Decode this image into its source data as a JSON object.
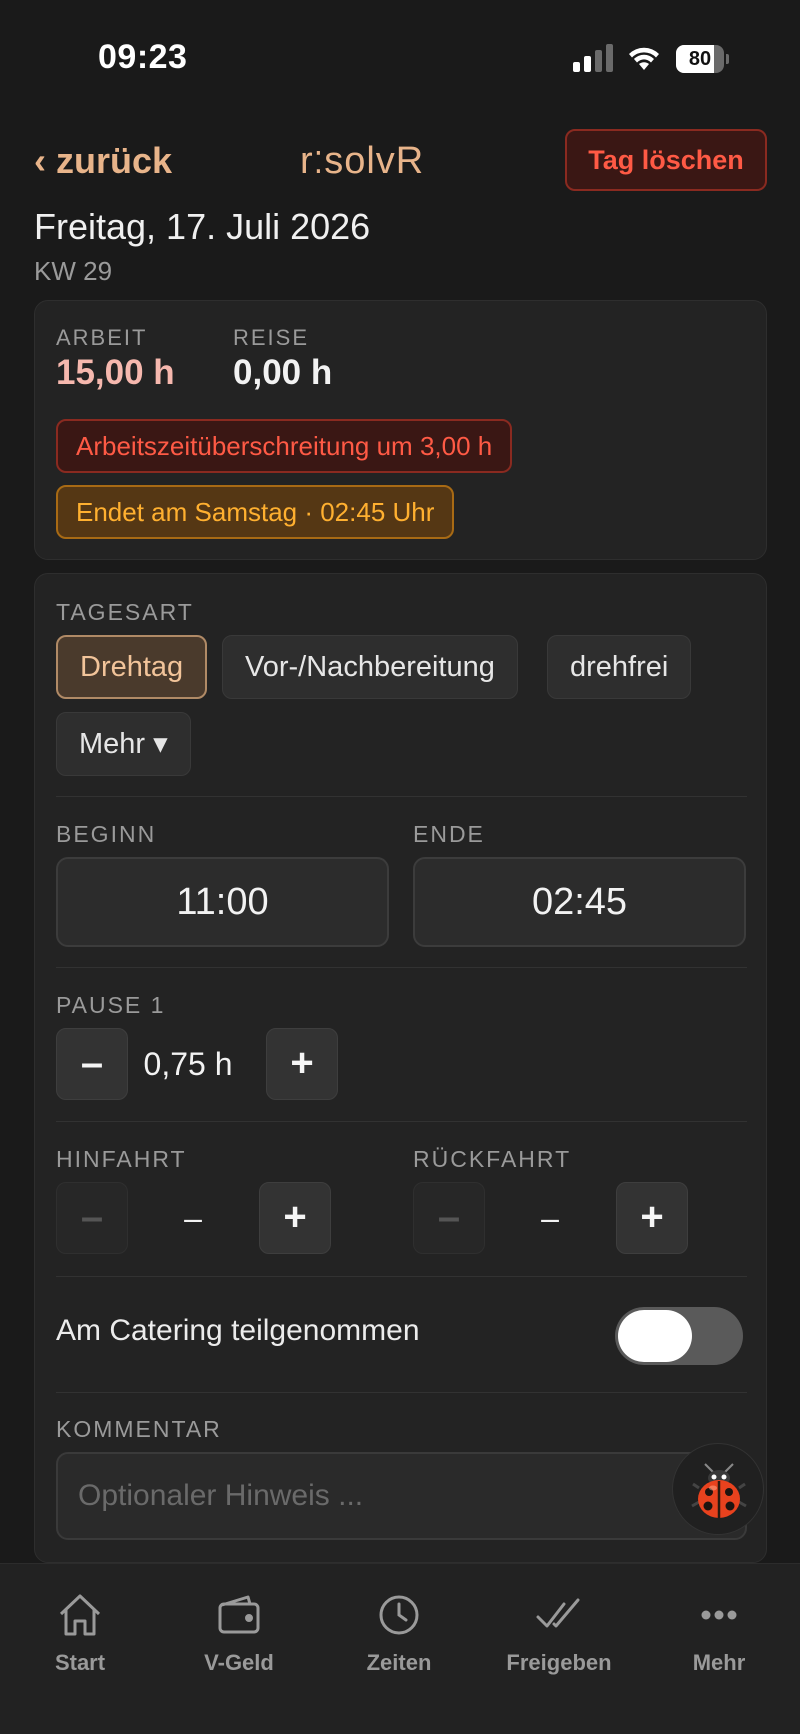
{
  "status_bar": {
    "time": "09:23",
    "battery": "80",
    "battery_level": 0.8
  },
  "header": {
    "back_label": "‹ zurück",
    "logo_left": "r",
    "logo_dots": "⁚",
    "logo_right": "solvR",
    "delete_label": "Tag löschen"
  },
  "day": {
    "title": "Freitag, 17. Juli 2026",
    "week": "KW 29"
  },
  "summary": {
    "work_label": "ARBEIT",
    "work_value": "15,00 h",
    "travel_label": "REISE",
    "travel_value": "0,00 h",
    "alert_overtime": "Arbeitszeitüberschreitung um 3,00 h",
    "alert_end": "Endet am Samstag · 02:45 Uhr"
  },
  "day_type": {
    "label": "TAGESART",
    "options": [
      "Drehtag",
      "Vor-/Nachbereitung",
      "drehfrei"
    ],
    "more": "Mehr ▾",
    "selected": "Drehtag"
  },
  "times": {
    "start_label": "BEGINN",
    "start_value": "11:00",
    "end_label": "ENDE",
    "end_value": "02:45"
  },
  "pause": {
    "label": "PAUSE 1",
    "value": "0,75 h",
    "minus": "–",
    "plus": "+"
  },
  "travel": {
    "outbound_label": "HINFAHRT",
    "outbound_value": "–",
    "return_label": "RÜCKFAHRT",
    "return_value": "–",
    "minus": "–",
    "plus": "+"
  },
  "catering": {
    "label": "Am Catering teilgenommen",
    "enabled": false
  },
  "comment": {
    "label": "KOMMENTAR",
    "placeholder": "Optionaler Hinweis ..."
  },
  "fab": {
    "icon": "ladybug-icon"
  },
  "tabbar": {
    "items": [
      "Start",
      "V-Geld",
      "Zeiten",
      "Freigeben",
      "Mehr"
    ]
  },
  "colors": {
    "accent": "#e8b48a",
    "danger": "#ff5a45",
    "warning": "#ffb030",
    "work_value": "#f6b8ae"
  }
}
